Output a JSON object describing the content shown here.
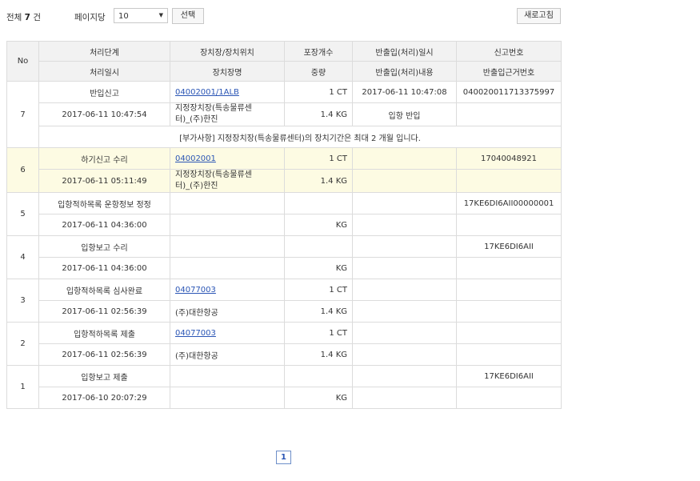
{
  "toolbar": {
    "total_prefix": "전체",
    "total_count": "7",
    "total_suffix": "건",
    "per_page_label": "페이지당",
    "per_page_value": "10",
    "select_label": "선택",
    "refresh_label": "새로고침"
  },
  "table": {
    "headers": {
      "no": "No",
      "stage": "처리단계",
      "location": "장치장/장치위치",
      "packages": "포장개수",
      "inout_datetime": "반출입(처리)일시",
      "report_no": "신고번호",
      "process_datetime": "처리일시",
      "location_name": "장치장명",
      "weight": "중량",
      "inout_detail": "반출입(처리)내용",
      "inout_basis": "반출입근거번호"
    },
    "rows": [
      {
        "no": "7",
        "stage": "반입신고",
        "location": "04002001/1ALB",
        "packages": "1 CT",
        "inout_datetime": "2017-06-11 10:47:08",
        "report_no": "040020011713375997",
        "process_datetime": "2017-06-11 10:47:54",
        "location_name": "지정장치장(특송물류센터)_(주)한진",
        "weight": "1.4 KG",
        "inout_detail": "입항 반입",
        "inout_basis": "",
        "note": "[부가사항] 지정장치장(특송물류센터)의 장치기간은 최대 2 개월 입니다."
      },
      {
        "no": "6",
        "stage": "하기신고 수리",
        "location": "04002001",
        "packages": "1 CT",
        "inout_datetime": "",
        "report_no": "17040048921",
        "process_datetime": "2017-06-11 05:11:49",
        "location_name": "지정장치장(특송물류센터)_(주)한진",
        "weight": "1.4 KG",
        "inout_detail": "",
        "inout_basis": ""
      },
      {
        "no": "5",
        "stage": "입항적하목록 운항정보 정정",
        "location": "",
        "packages": "",
        "inout_datetime": "",
        "report_no": "17KE6DI6AII00000001",
        "process_datetime": "2017-06-11 04:36:00",
        "location_name": "",
        "weight": "KG",
        "inout_detail": "",
        "inout_basis": ""
      },
      {
        "no": "4",
        "stage": "입항보고 수리",
        "location": "",
        "packages": "",
        "inout_datetime": "",
        "report_no": "17KE6DI6AII",
        "process_datetime": "2017-06-11 04:36:00",
        "location_name": "",
        "weight": "KG",
        "inout_detail": "",
        "inout_basis": ""
      },
      {
        "no": "3",
        "stage": "입항적하목록 심사완료",
        "location": "04077003",
        "packages": "1 CT",
        "inout_datetime": "",
        "report_no": "",
        "process_datetime": "2017-06-11 02:56:39",
        "location_name": "(주)대한항공",
        "weight": "1.4 KG",
        "inout_detail": "",
        "inout_basis": ""
      },
      {
        "no": "2",
        "stage": "입항적하목록 제출",
        "location": "04077003",
        "packages": "1 CT",
        "inout_datetime": "",
        "report_no": "",
        "process_datetime": "2017-06-11 02:56:39",
        "location_name": "(주)대한항공",
        "weight": "1.4 KG",
        "inout_detail": "",
        "inout_basis": ""
      },
      {
        "no": "1",
        "stage": "입항보고 제출",
        "location": "",
        "packages": "",
        "inout_datetime": "",
        "report_no": "17KE6DI6AII",
        "process_datetime": "2017-06-10 20:07:29",
        "location_name": "",
        "weight": "KG",
        "inout_detail": "",
        "inout_basis": ""
      }
    ]
  },
  "pagination": {
    "current": "1"
  },
  "colors": {
    "header_bg": "#f2f2f2",
    "highlight_bg": "#fdfbe3",
    "link": "#2a55b5",
    "border": "#dcdcdc"
  }
}
